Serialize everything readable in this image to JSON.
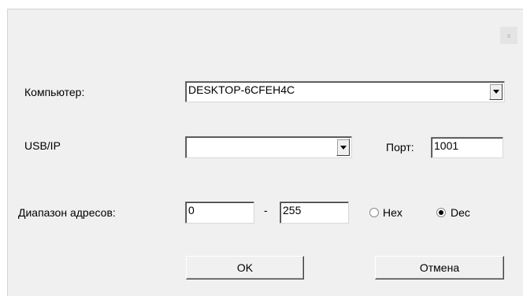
{
  "dialog": {
    "close_label": "x",
    "computer": {
      "label": "Компьютер:",
      "value": "DESKTOP-6CFEH4C"
    },
    "usbip": {
      "label": "USB/IP",
      "value": "",
      "port_label": "Порт:",
      "port_value": "1001"
    },
    "address_range": {
      "label": "Диапазон адресов:",
      "from": "0",
      "separator": "-",
      "to": "255",
      "hex_label": "Hex",
      "dec_label": "Dec",
      "selected": "Dec"
    },
    "ok_label": "OK",
    "cancel_label": "Отмена"
  }
}
